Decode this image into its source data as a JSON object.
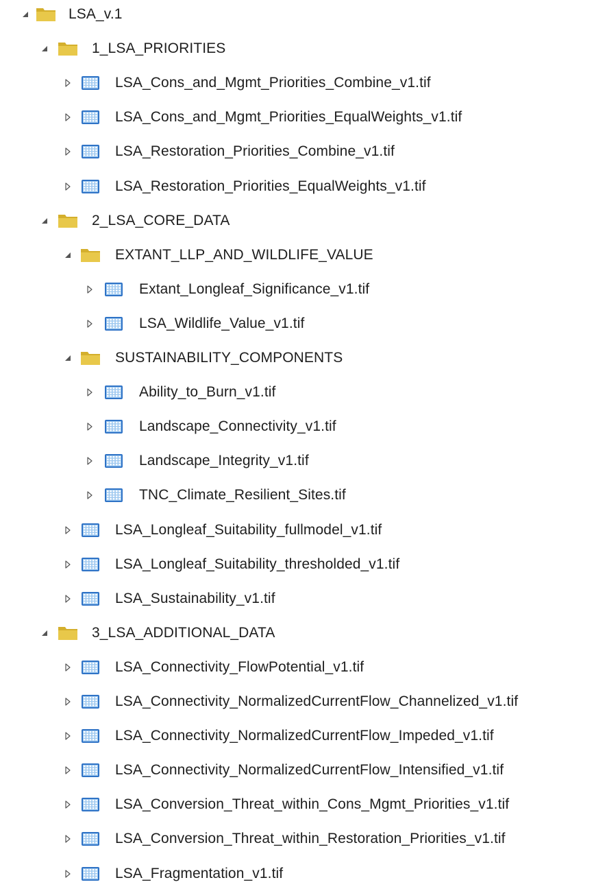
{
  "tree": {
    "root": {
      "label": "LSA_v.1",
      "expanded": true,
      "icon": "folder-icon"
    },
    "priorities": {
      "label": "1_LSA_PRIORITIES",
      "expanded": true,
      "icon": "folder-icon",
      "items": [
        {
          "label": "LSA_Cons_and_Mgmt_Priorities_Combine_v1.tif",
          "icon": "raster-icon"
        },
        {
          "label": "LSA_Cons_and_Mgmt_Priorities_EqualWeights_v1.tif",
          "icon": "raster-icon"
        },
        {
          "label": "LSA_Restoration_Priorities_Combine_v1.tif",
          "icon": "raster-icon"
        },
        {
          "label": "LSA_Restoration_Priorities_EqualWeights_v1.tif",
          "icon": "raster-icon"
        }
      ]
    },
    "core_data": {
      "label": "2_LSA_CORE_DATA",
      "expanded": true,
      "icon": "folder-icon",
      "extant": {
        "label": "EXTANT_LLP_AND_WILDLIFE_VALUE",
        "expanded": true,
        "icon": "folder-icon",
        "items": [
          {
            "label": "Extant_Longleaf_Significance_v1.tif",
            "icon": "raster-icon"
          },
          {
            "label": "LSA_Wildlife_Value_v1.tif",
            "icon": "raster-icon"
          }
        ]
      },
      "sustainability": {
        "label": "SUSTAINABILITY_COMPONENTS",
        "expanded": true,
        "icon": "folder-icon",
        "items": [
          {
            "label": "Ability_to_Burn_v1.tif",
            "icon": "raster-icon"
          },
          {
            "label": "Landscape_Connectivity_v1.tif",
            "icon": "raster-icon"
          },
          {
            "label": "Landscape_Integrity_v1.tif",
            "icon": "raster-icon"
          },
          {
            "label": "TNC_Climate_Resilient_Sites.tif",
            "icon": "raster-icon"
          }
        ]
      },
      "items": [
        {
          "label": "LSA_Longleaf_Suitability_fullmodel_v1.tif",
          "icon": "raster-icon"
        },
        {
          "label": "LSA_Longleaf_Suitability_thresholded_v1.tif",
          "icon": "raster-icon"
        },
        {
          "label": "LSA_Sustainability_v1.tif",
          "icon": "raster-icon"
        }
      ]
    },
    "additional": {
      "label": "3_LSA_ADDITIONAL_DATA",
      "expanded": true,
      "icon": "folder-icon",
      "items": [
        {
          "label": "LSA_Connectivity_FlowPotential_v1.tif",
          "icon": "raster-icon"
        },
        {
          "label": "LSA_Connectivity_NormalizedCurrentFlow_Channelized_v1.tif",
          "icon": "raster-icon"
        },
        {
          "label": "LSA_Connectivity_NormalizedCurrentFlow_Impeded_v1.tif",
          "icon": "raster-icon"
        },
        {
          "label": "LSA_Connectivity_NormalizedCurrentFlow_Intensified_v1.tif",
          "icon": "raster-icon"
        },
        {
          "label": "LSA_Conversion_Threat_within_Cons_Mgmt_Priorities_v1.tif",
          "icon": "raster-icon"
        },
        {
          "label": "LSA_Conversion_Threat_within_Restoration_Priorities_v1.tif",
          "icon": "raster-icon"
        },
        {
          "label": "LSA_Fragmentation_v1.tif",
          "icon": "raster-icon"
        }
      ]
    }
  },
  "colors": {
    "folder": "#e8c84a",
    "folder_dark": "#d4af2c",
    "raster_frame": "#2f73c6",
    "raster_fill": "#9fc9f0",
    "arrow": "#555555",
    "text": "#1e1e1e"
  }
}
